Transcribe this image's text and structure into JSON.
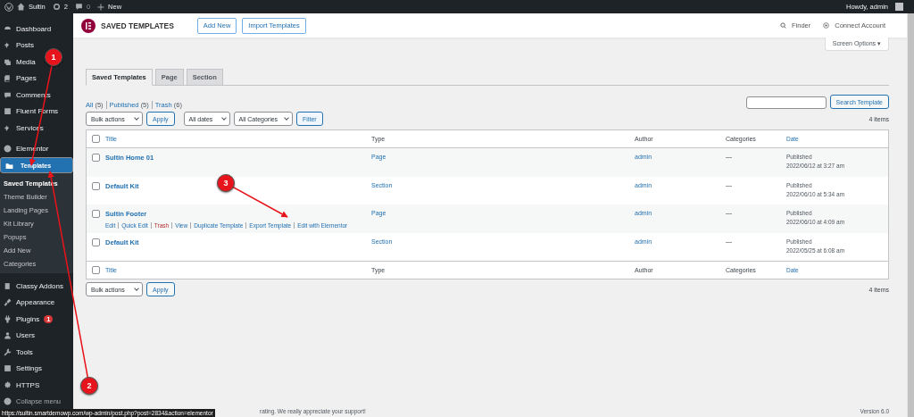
{
  "admin_bar": {
    "site": "Sultin",
    "updates": "2",
    "comments": "0",
    "new": "New",
    "greeting": "Howdy, admin"
  },
  "sidebar": {
    "items": [
      {
        "label": "Dashboard",
        "selected": false
      },
      {
        "label": "Posts",
        "selected": false
      },
      {
        "label": "Media",
        "selected": false
      },
      {
        "label": "Pages",
        "selected": false
      },
      {
        "label": "Comments",
        "selected": false
      },
      {
        "label": "Fluent Forms",
        "selected": false
      },
      {
        "label": "Services",
        "selected": false
      },
      {
        "label": "Elementor",
        "selected": false
      },
      {
        "label": "Templates",
        "selected": true,
        "children": [
          {
            "label": "Saved Templates",
            "selected": true
          },
          {
            "label": "Theme Builder",
            "selected": false
          },
          {
            "label": "Landing Pages",
            "selected": false
          },
          {
            "label": "Kit Library",
            "selected": false
          },
          {
            "label": "Popups",
            "selected": false
          },
          {
            "label": "Add New",
            "selected": false
          },
          {
            "label": "Categories",
            "selected": false
          }
        ]
      },
      {
        "label": "Classy Addons",
        "selected": false
      },
      {
        "label": "Appearance",
        "selected": false
      },
      {
        "label": "Plugins",
        "selected": false,
        "badge": "1"
      },
      {
        "label": "Users",
        "selected": false
      },
      {
        "label": "Tools",
        "selected": false
      },
      {
        "label": "Settings",
        "selected": false
      },
      {
        "label": "HTTPS",
        "selected": false
      },
      {
        "label": "Collapse menu",
        "selected": false
      }
    ]
  },
  "header": {
    "title": "SAVED TEMPLATES",
    "buttons": [
      "Add New",
      "Import Templates"
    ],
    "finder": "Finder",
    "connect": "Connect Account"
  },
  "screen_options": "Screen Options ▾",
  "tabs": [
    {
      "label": "Saved Templates",
      "selected": true
    },
    {
      "label": "Page",
      "selected": false
    },
    {
      "label": "Section",
      "selected": false
    }
  ],
  "views": [
    {
      "label": "All",
      "count": "(5)"
    },
    {
      "label": "Published",
      "count": "(5)"
    },
    {
      "label": "Trash",
      "count": "(6)"
    }
  ],
  "search_button": "Search Template",
  "filters": {
    "bulk": "Bulk actions",
    "apply": "Apply",
    "dates": "All dates",
    "categories": "All Categories",
    "filter": "Filter"
  },
  "items_count": "4 items",
  "table": {
    "header": {
      "checked": false,
      "columns": [
        "Title",
        "Type",
        "Author",
        "Categories",
        "Date"
      ]
    },
    "rows": [
      {
        "checked": false,
        "title": "Sultin Home 01",
        "type": "Page",
        "author": "admin",
        "categories": "—",
        "status": "Published",
        "date": "2022/06/12 at 3:27 am",
        "actions": []
      },
      {
        "checked": false,
        "title": "Default Kit",
        "type": "Section",
        "author": "admin",
        "categories": "—",
        "status": "Published",
        "date": "2022/06/10 at 5:34 am",
        "actions": []
      },
      {
        "checked": false,
        "title": "Sultin Footer",
        "type": "Page",
        "author": "admin",
        "categories": "—",
        "status": "Published",
        "date": "2022/06/10 at 4:09 am",
        "actions": [
          {
            "label": "Edit",
            "kind": "link"
          },
          {
            "label": "Quick Edit",
            "kind": "link"
          },
          {
            "label": "Trash",
            "kind": "danger"
          },
          {
            "label": "View",
            "kind": "link"
          },
          {
            "label": "Duplicate Template",
            "kind": "link"
          },
          {
            "label": "Export Template",
            "kind": "link"
          },
          {
            "label": "Edit with Elementor",
            "kind": "link"
          }
        ]
      },
      {
        "checked": false,
        "title": "Default Kit",
        "type": "Section",
        "author": "admin",
        "categories": "—",
        "status": "Published",
        "date": "2022/05/25 at 6:08 am",
        "actions": []
      }
    ],
    "footer": {
      "checked": false,
      "columns": [
        "Title",
        "Type",
        "Author",
        "Categories",
        "Date"
      ]
    }
  },
  "bottom": {
    "bulk": "Bulk actions",
    "apply": "Apply",
    "items_count": "4 items"
  },
  "footer": {
    "thanks": "rating. We really appreciate your support!",
    "version": "Version 6.0"
  },
  "status_url": "https://sultin.smartdemowp.com/wp-admin/post.php?post=2834&action=elementor",
  "annotations": [
    {
      "label": "1"
    },
    {
      "label": "2"
    },
    {
      "label": "3"
    }
  ]
}
